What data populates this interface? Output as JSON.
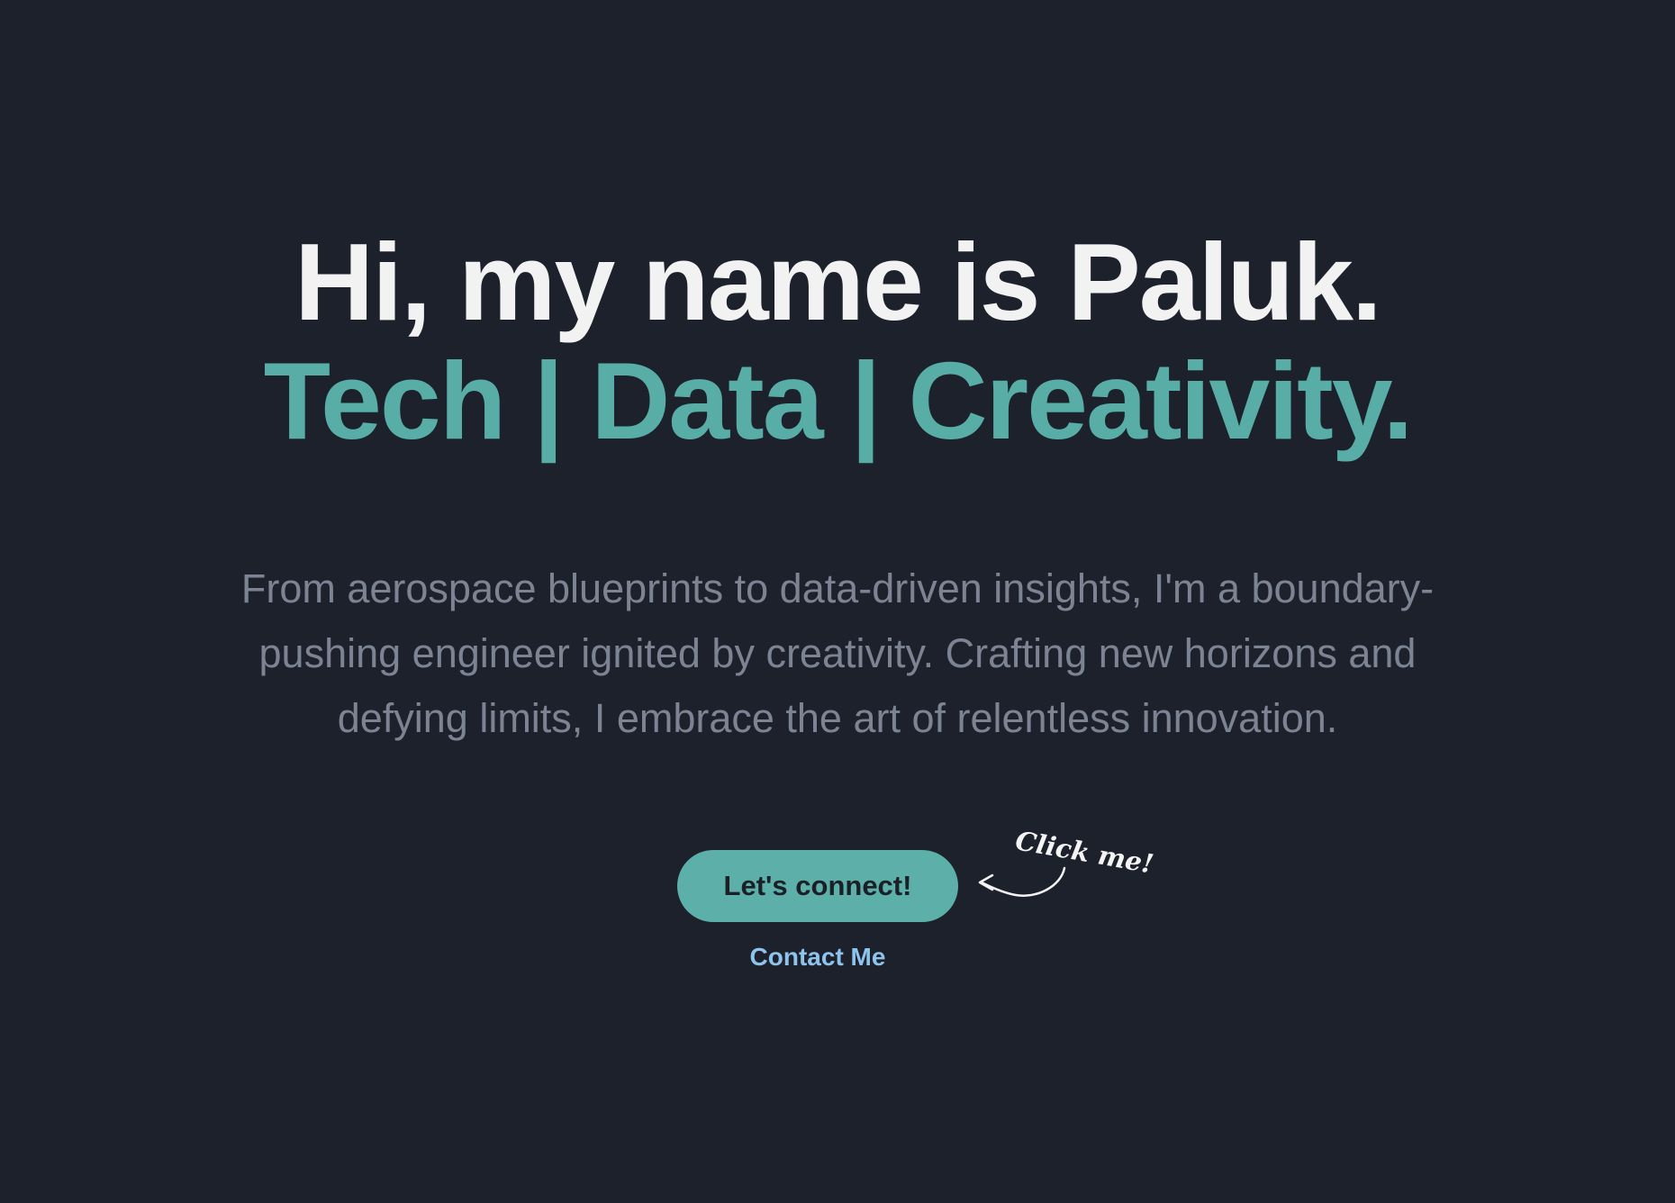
{
  "hero": {
    "headline": "Hi, my name is Paluk.",
    "tagline": "Tech | Data | Creativity.",
    "description": "From aerospace blueprints to data-driven insights, I'm a boundary-pushing engineer ignited by creativity. Crafting new horizons and defying limits, I embrace the art of relentless innovation."
  },
  "cta": {
    "button_label": "Let's connect!",
    "annotation": "Click me!",
    "link_label": "Contact Me"
  },
  "colors": {
    "background": "#1d212b",
    "headline": "#f2f2f2",
    "accent": "#58aea7",
    "body_text": "#7c8494",
    "link": "#8dc3ec"
  },
  "icons": {
    "annotation_arrow": "curved-arrow-icon"
  }
}
